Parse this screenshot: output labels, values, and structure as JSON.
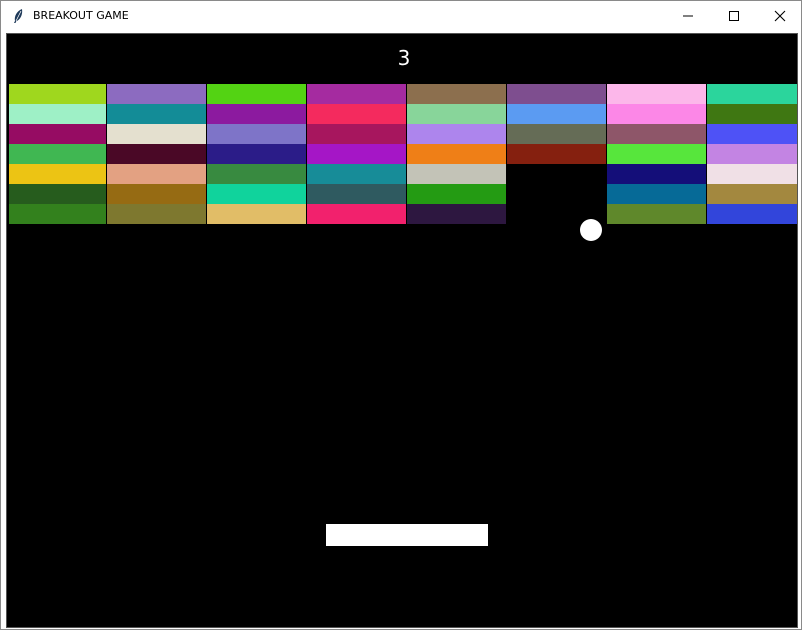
{
  "window": {
    "title": "BREAKOUT GAME",
    "app_icon": "feather-icon",
    "controls": [
      "minimize-icon",
      "maximize-icon",
      "close-icon"
    ]
  },
  "game": {
    "score": "3",
    "canvas_background": "#000000",
    "ball_color": "#ffffff",
    "paddle_color": "#ffffff",
    "bricks": [
      [
        "#9fd71e",
        "#8c6bc0",
        "#53d313",
        "#a52ba0",
        "#8c6f4e",
        "#7e4e8f",
        "#fcb7ea",
        "#2bd59c"
      ],
      [
        "#9ef0c6",
        "#138c97",
        "#8c1a9f",
        "#f42a5e",
        "#88d59a",
        "#5b9bf2",
        "#fc87e7",
        "#3f7712"
      ],
      [
        "#960c63",
        "#e4e0cf",
        "#7e74c8",
        "#a7165e",
        "#ad85ed",
        "#656c56",
        "#8e5669",
        "#4e52f6"
      ],
      [
        "#40b752",
        "#4a0826",
        "#2b1c88",
        "#a516c6",
        "#ef7f17",
        "#85200f",
        "#57e63c",
        "#c384e3"
      ],
      [
        "#ecc414",
        "#e3a182",
        "#388a40",
        "#178c98",
        "#c3c3b7",
        null,
        "#140e79",
        "#f0e0e6"
      ],
      [
        "#265c1d",
        "#966b13",
        "#10d39c",
        "#2f5a60",
        "#249b13",
        null,
        "#066a97",
        "#a3883f"
      ],
      [
        "#33811d",
        "#7e782f",
        "#e1bd67",
        "#f2216d",
        "#2d1740",
        null,
        "#5f882b",
        "#3245db"
      ]
    ]
  }
}
